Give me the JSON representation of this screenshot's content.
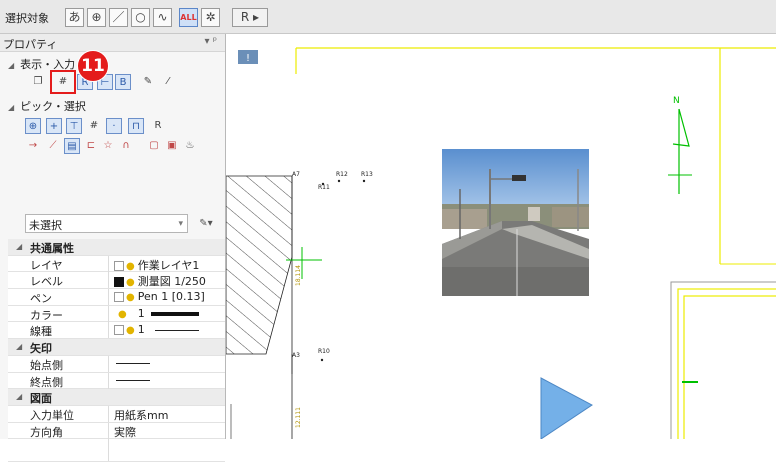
{
  "toolbar": {
    "label": "選択対象",
    "buttons": [
      "あ",
      "⊕",
      "／",
      "○",
      "∿",
      "ALL",
      "✲"
    ],
    "extra_button": "R ▸"
  },
  "panel": {
    "title": "プロパティ",
    "pin": "▾ ᵖ",
    "group1": "表示・入力",
    "group2": "ピック・選択",
    "badge": "11",
    "select_value": "未選択",
    "sections": [
      {
        "title": "共通属性",
        "rows": [
          {
            "k": "レイヤ",
            "v": "作業レイヤ1"
          },
          {
            "k": "レベル",
            "v": "測量図 1/250"
          },
          {
            "k": "ペン",
            "v": "Pen 1 [0.13]"
          },
          {
            "k": "カラー",
            "v": "1"
          },
          {
            "k": "線種",
            "v": "1"
          }
        ]
      },
      {
        "title": "矢印",
        "rows": [
          {
            "k": "始点側",
            "v": ""
          },
          {
            "k": "終点側",
            "v": ""
          }
        ]
      },
      {
        "title": "図面",
        "rows": [
          {
            "k": "入力単位",
            "v": "用紙系mm"
          },
          {
            "k": "方向角",
            "v": "実際"
          }
        ]
      }
    ]
  },
  "canvas": {
    "labels": {
      "a7": "A7",
      "r11": "R11",
      "r12": "R12",
      "r13": "R13",
      "a3": "A3",
      "r10": "R10",
      "north": "N",
      "dim1": "18.114",
      "dim2": "12.111"
    }
  },
  "colors": {
    "accent": "#e41c1c",
    "selection": "#cfe0f7",
    "drawing_yellow": "#ecec00",
    "drawing_green": "#00c000"
  }
}
